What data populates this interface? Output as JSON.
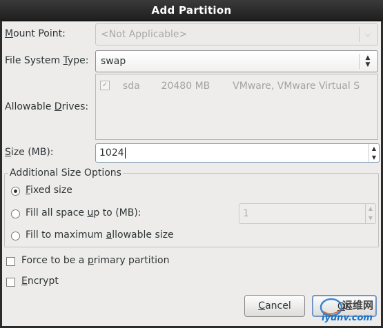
{
  "window": {
    "title": "Add Partition"
  },
  "mount_point": {
    "label_pre": "",
    "label_mn": "M",
    "label_post": "ount Point:",
    "value": "<Not Applicable>"
  },
  "fs_type": {
    "label_pre": "File System ",
    "label_mn": "T",
    "label_post": "ype:",
    "value": "swap"
  },
  "drives": {
    "label_pre": "Allowable ",
    "label_mn": "D",
    "label_post": "rives:",
    "rows": [
      {
        "checked": "✓",
        "name": "sda",
        "size": "20480 MB",
        "model": "VMware, VMware Virtual S"
      }
    ]
  },
  "size": {
    "label_pre": "",
    "label_mn": "S",
    "label_post": "ize (MB):",
    "value": "1024"
  },
  "options": {
    "title": "Additional Size Options",
    "fixed": {
      "pre": "",
      "mn": "F",
      "post": "ixed size"
    },
    "fill_upto": {
      "pre": "Fill all space ",
      "mn": "u",
      "post": "p to (MB):",
      "value": "1"
    },
    "fill_max": {
      "pre": "Fill to maximum ",
      "mn": "a",
      "post": "llowable size"
    }
  },
  "primary": {
    "pre": "Force to be a ",
    "mn": "p",
    "post": "rimary partition"
  },
  "encrypt": {
    "pre": "",
    "mn": "E",
    "post": "ncrypt"
  },
  "buttons": {
    "cancel_mn": "C",
    "cancel_post": "ancel",
    "ok_mn": "O",
    "ok_post": "K"
  },
  "watermark": {
    "text": "运维网",
    "url": "iyunv.com"
  }
}
